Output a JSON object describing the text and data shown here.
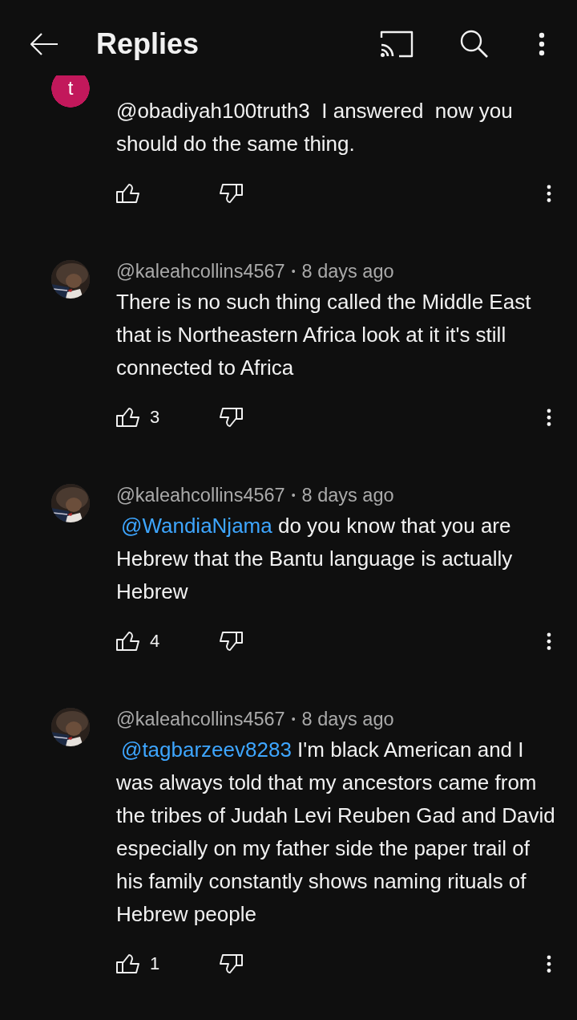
{
  "header": {
    "title": "Replies"
  },
  "comments": [
    {
      "avatar": {
        "kind": "letter",
        "letter": "t",
        "color": "#c2185b",
        "partial": true
      },
      "text": [
        {
          "kind": "text",
          "text": "@obadiyah100truth3  I answered  now you should do the same thing."
        }
      ]
    },
    {
      "avatar": {
        "kind": "picture"
      },
      "author": "@kaleahcollins4567",
      "separator": "•",
      "time": "8 days ago",
      "text": [
        {
          "kind": "text",
          "text": "There is no such thing called the Middle East that is Northeastern Africa look at it it's still connected to Africa"
        }
      ],
      "likes": "3"
    },
    {
      "avatar": {
        "kind": "picture"
      },
      "author": "@kaleahcollins4567",
      "separator": "•",
      "time": "8 days ago",
      "text": [
        {
          "kind": "mention",
          "text": "@WandiaNjama"
        },
        {
          "kind": "text",
          "text": " do you know that you are Hebrew that the Bantu language is actually Hebrew"
        }
      ],
      "likes": "4"
    },
    {
      "avatar": {
        "kind": "picture"
      },
      "author": "@kaleahcollins4567",
      "separator": "•",
      "time": "8 days ago",
      "text": [
        {
          "kind": "mention",
          "text": "@tagbarzeev8283"
        },
        {
          "kind": "text",
          "text": " I'm black American and I was always told that my ancestors came from the tribes of Judah Levi Reuben Gad and David especially on my father side the paper trail of his family constantly shows naming rituals of Hebrew people"
        }
      ],
      "likes": "1"
    }
  ]
}
